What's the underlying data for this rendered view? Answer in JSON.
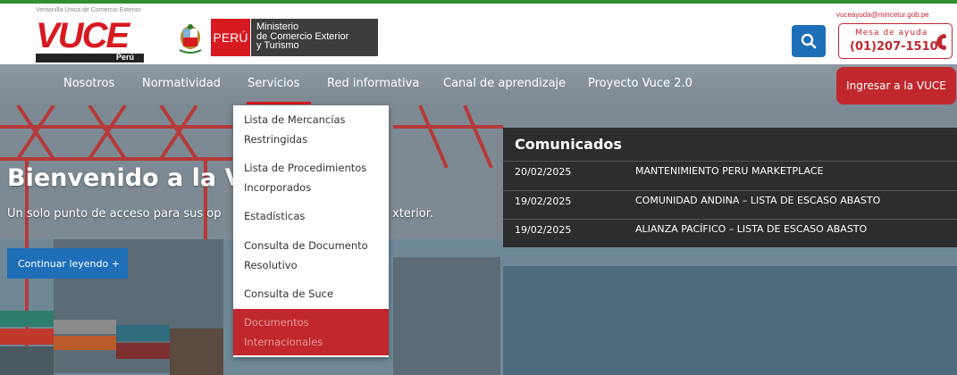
{
  "header": {
    "tagline": "Ventanilla Única de Comercio Exterior",
    "logo_word": "VUCE",
    "logo_country": "Perú",
    "peru_label": "PERÚ",
    "ministry_lines": [
      "Ministerio",
      "de Comercio Exterior",
      "y Turismo"
    ],
    "email": "vuceayuda@mincetur.gob.pe",
    "help_label": "Mesa de ayuda",
    "help_phone": "(01)207-1510",
    "search_icon": "search-icon",
    "phone_icon": "phone-icon"
  },
  "nav": {
    "items": [
      "Nosotros",
      "Normatividad",
      "Servicios",
      "Red informativa",
      "Canal de aprendizaje",
      "Proyecto Vuce 2.0"
    ],
    "active": "Servicios",
    "login_label": "Ingresar a la VUCE",
    "accent_color": "#c0282e"
  },
  "dropdown": {
    "items": [
      "Lista de Mercancías Restringidas",
      "Lista de Procedimientos Incorporados",
      "Estadísticas",
      "Consulta de Documento Resolutivo",
      "Consulta de Suce",
      "Documentos Internacionales"
    ],
    "highlighted": "Documentos Internacionales"
  },
  "hero": {
    "title": "Bienvenido a la VU",
    "subtitle_left": "Un solo punto de acceso para sus op",
    "subtitle_right": "xterior.",
    "button_label": "Continuar leyendo +"
  },
  "comunicados": {
    "title": "Comunicados",
    "rows": [
      {
        "date": "20/02/2025",
        "text": "MANTENIMIENTO PERU MARKETPLACE"
      },
      {
        "date": "19/02/2025",
        "text": "COMUNIDAD ANDINA – LISTA DE ESCASO ABASTO"
      },
      {
        "date": "19/02/2025",
        "text": "ALIANZA PACÍFICO – LISTA DE ESCASO ABASTO"
      }
    ]
  }
}
